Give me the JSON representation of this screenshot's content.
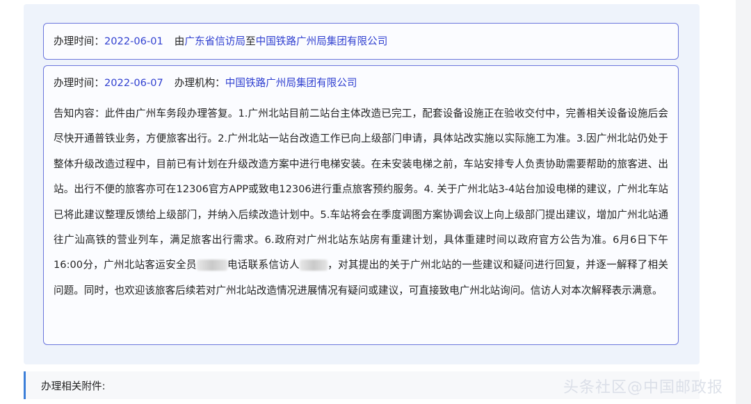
{
  "record1": {
    "time_label": "办理时间：",
    "time_value": "2022-06-01",
    "from_prefix": "由",
    "from_org": "广东省信访局",
    "to_word": "至",
    "to_org": "中国铁路广州局集团有限公司"
  },
  "record2": {
    "time_label": "办理时间：",
    "time_value": "2022-06-07",
    "agency_label": "办理机构：",
    "agency_value": "中国铁路广州局集团有限公司",
    "notice_label": "告知内容：",
    "notice_part1": "此件由广州车务段办理答复。1.广州北站目前二站台主体改造已完工，配套设备设施正在验收交付中，完善相关设备设施后会尽快开通普铁业务，方便旅客出行。2.广州北站一站台改造工作已向上级部门申请，具体站改实施以实际施工为准。3.因广州北站仍处于整体升级改造过程中，目前已有计划在升级改造方案中进行电梯安装。在未安装电梯之前，车站安排专人负责协助需要帮助的旅客进、出站。出行不便的旅客亦可在12306官方APP或致电12306进行重点旅客预约服务。4. 关于广州北站3-4站台加设电梯的建议，广州北车站已将此建议整理反馈给上级部门，并纳入后续改造计划中。5.车站将会在季度调图方案协调会议上向上级部门提出建议，增加广州北站通往广汕高铁的营业列车，满足旅客出行需求。6.政府对广州北站东站房有重建计划，具体重建时间以政府官方公告为准。6月6日下午16:00分，广州北站客运安全员",
    "notice_part2": "电话联系信访人",
    "notice_part3": "，对其提出的关于广州北站的一些建议和疑问进行回复，并逐一解释了相关问题。同时，也欢迎该旅客后续若对广州北站改造情况进展情况有疑问或建议，可直接致电广州北站询问。信访人对本次解释表示满意。"
  },
  "attachments": {
    "label": "办理相关附件:"
  },
  "watermark": "头条社区@中国邮政报"
}
